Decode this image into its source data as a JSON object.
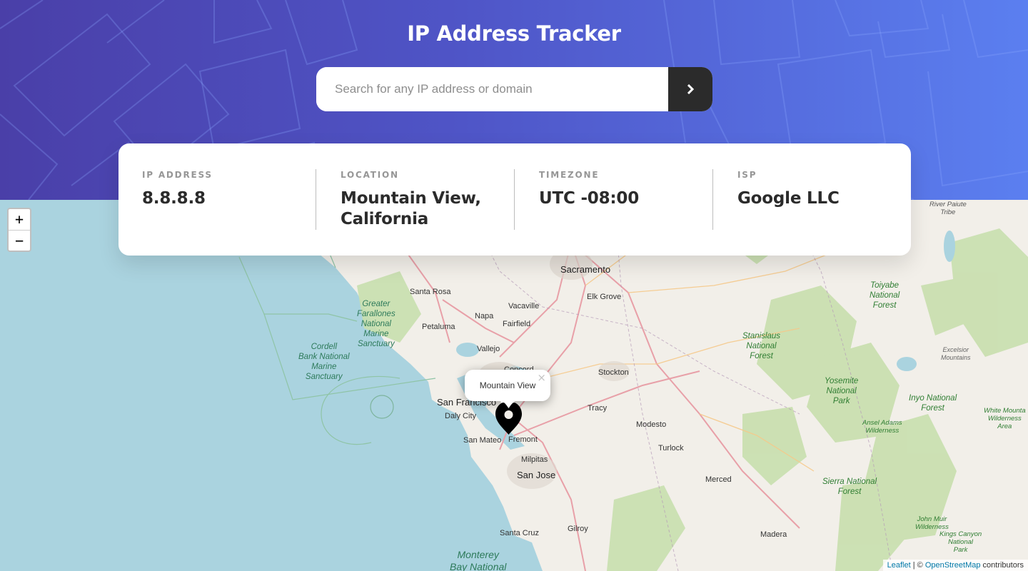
{
  "header": {
    "title": "IP Address Tracker",
    "search_placeholder": "Search for any IP address or domain",
    "search_value": ""
  },
  "info": [
    {
      "label": "IP ADDRESS",
      "value": "8.8.8.8"
    },
    {
      "label": "LOCATION",
      "value": "Mountain View, California"
    },
    {
      "label": "TIMEZONE",
      "value": "UTC -08:00"
    },
    {
      "label": "ISP",
      "value": "Google LLC"
    }
  ],
  "map": {
    "zoom_in": "+",
    "zoom_out": "−",
    "popup_text": "Mountain View",
    "popup_close": "×",
    "attribution": {
      "leaflet": "Leaflet",
      "separator": " | © ",
      "osm": "OpenStreetMap",
      "suffix": " contributors"
    },
    "labels": {
      "sacramento": "Sacramento",
      "elk_grove": "Elk Grove",
      "santa_rosa": "Santa Rosa",
      "vacaville": "Vacaville",
      "napa": "Napa",
      "fairfield": "Fairfield",
      "petaluma": "Petaluma",
      "vallejo": "Vallejo",
      "concord": "Concord",
      "stockton": "Stockton",
      "san_francisco": "San Francisco",
      "daly_city": "Daly City",
      "san_mateo": "San Mateo",
      "fremont": "Fremont",
      "milpitas": "Milpitas",
      "san_jose": "San Jose",
      "tracy": "Tracy",
      "modesto": "Modesto",
      "turlock": "Turlock",
      "merced": "Merced",
      "gilroy": "Gilroy",
      "santa_cruz": "Santa Cruz",
      "madera": "Madera",
      "greater_farallones": "Greater\nFarallones\nNational\nMarine\nSanctuary",
      "cordell_bank": "Cordell\nBank National\nMarine\nSanctuary",
      "monterey_bay": "Monterey\nBay National",
      "stanislaus": "Stanislaus\nNational\nForest",
      "yosemite": "Yosemite\nNational\nPark",
      "toiyabe": "Toiyabe\nNational\nForest",
      "inyo": "Inyo National\nForest",
      "sierra": "Sierra National\nForest",
      "white_mountain": "White Mounta\nWilderness\nArea",
      "ansel_adams": "Ansel Adams\nWilderness",
      "john_muir": "John Muir\nWilderness",
      "kings_canyon": "Kings Canyon\nNational\nPark",
      "excelsior": "Excelsior\nMountains",
      "river_paiute": "River Paiute\nTribe"
    }
  },
  "colors": {
    "header_start": "#4a3fa8",
    "header_end": "#5b7ff0",
    "dark": "#2b2b2b",
    "label_gray": "#969696",
    "water": "#aad3df",
    "land": "#f2efe9",
    "park": "#c8dfae"
  }
}
